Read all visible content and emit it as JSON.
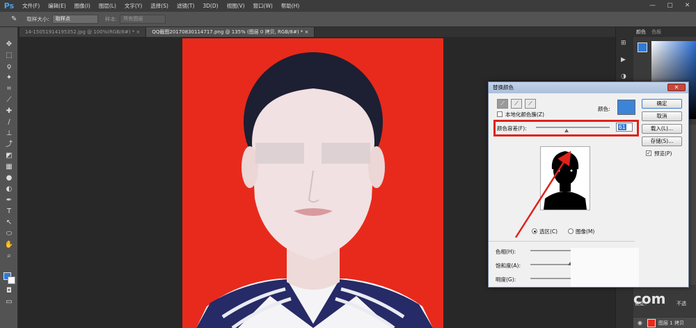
{
  "app": {
    "logo": "Ps"
  },
  "menu": [
    "文件(F)",
    "编辑(E)",
    "图像(I)",
    "图层(L)",
    "文字(Y)",
    "选择(S)",
    "滤镜(T)",
    "3D(D)",
    "视图(V)",
    "窗口(W)",
    "帮助(H)"
  ],
  "window_controls": {
    "minimize": "—",
    "restore": "▢",
    "close": "✕"
  },
  "options": {
    "sample_size_label": "取样大小:",
    "sample_size_value": "取样点",
    "sample_label": "样本:",
    "sample_value": "所有图层"
  },
  "tabs": [
    {
      "label": "14-15051914195352.jpg @ 100%(RGB/8#) *  ×",
      "active": false
    },
    {
      "label": "QQ截图20170830114717.png @ 135% (图层 0 拷贝, RGB/8#) *  ×",
      "active": true
    }
  ],
  "right_panel": {
    "tab_color": "颜色",
    "tab_swatches": "色板",
    "lock_label": "锁定:",
    "opacity_label": "不透",
    "layer_label": "图层 1 拷贝",
    "watermark": "com",
    "fg_color": "#2f7ad8",
    "bg_color": "#ffffff"
  },
  "dialog": {
    "title": "替换颜色",
    "close": "✕",
    "localized_label": "本地化颜色簇(Z)",
    "color_label": "颜色:",
    "color_swatch": "#3d84d6",
    "fuzziness_label": "颜色容差(F):",
    "fuzziness_value": "61",
    "radio_selection": "选区(C)",
    "radio_image": "图像(M)",
    "hue_label": "色相(H):",
    "saturation_label": "饱和度(A):",
    "lightness_label": "明度(G):",
    "btn_ok": "确定",
    "btn_cancel": "取消",
    "btn_load": "载入(L)...",
    "btn_save": "存储(S)...",
    "preview_label": "预览(P)",
    "preview_checked": true,
    "selection_mode": "selection"
  },
  "annotation": {
    "highlight_color": "#e0221a"
  },
  "colors": {
    "canvas_bg": "#e82a1c"
  }
}
